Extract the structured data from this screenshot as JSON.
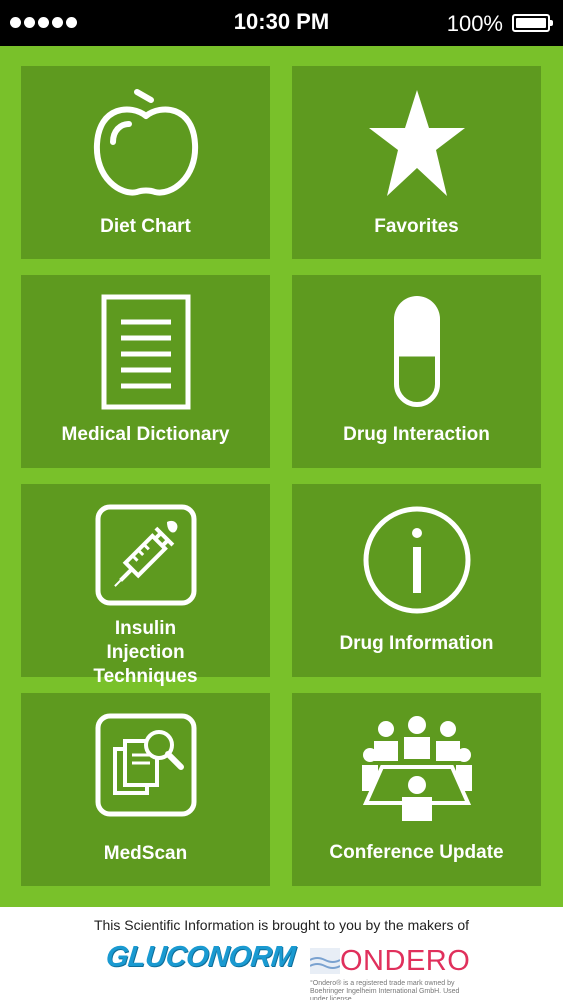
{
  "status_bar": {
    "time": "10:30 PM",
    "battery": "100%"
  },
  "tiles": [
    {
      "label": "Diet Chart",
      "icon": "apple-icon"
    },
    {
      "label": "Favorites",
      "icon": "star-icon"
    },
    {
      "label": "Medical Dictionary",
      "icon": "document-icon"
    },
    {
      "label": "Drug Interaction",
      "icon": "capsule-icon"
    },
    {
      "label": "Insulin Injection Techniques",
      "icon": "syringe-icon"
    },
    {
      "label": "Drug Information",
      "icon": "info-icon"
    },
    {
      "label": "MedScan",
      "icon": "medscan-icon"
    },
    {
      "label": "Conference Update",
      "icon": "conference-icon"
    }
  ],
  "footer": {
    "text": "This Scientific Information is brought to you by the makers of",
    "brand1": "GLUCONORM",
    "brand2": "ONDERO",
    "brand2_note": "°Ondero® is a registered trade mark owned by Boehringer Ingelheim International GmbH. Used under license."
  },
  "colors": {
    "background": "#79c12a",
    "tile": "#5e9a1f",
    "gluconorm": "#1a9ad1",
    "ondero": "#e0305c"
  }
}
